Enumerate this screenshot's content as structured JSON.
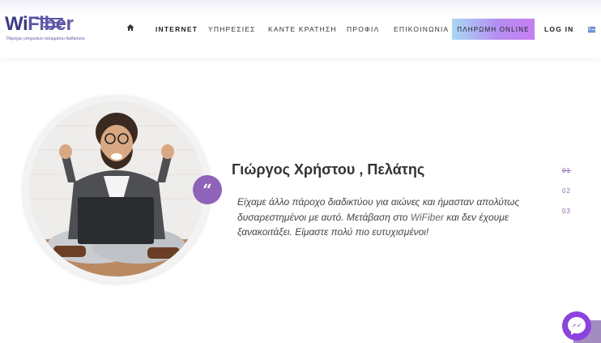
{
  "brand": {
    "logo_text_1": "Wi",
    "logo_text_2": "Fiber",
    "tagline": "Πάροχος υπηρεσιών ασύρματου διαδικτύου"
  },
  "nav": {
    "home_icon": "home-icon",
    "items": [
      "INTERNET",
      "ΥΠΗΡΕΣΙΕΣ",
      "ΚΑΝΤΕ ΚΡΑΤΗΣΗ",
      "ΠΡΟΦΙΛ",
      "ΕΠΙΚΟΙΝΩΝΙΑ"
    ],
    "pay_label": "ΠΛΗΡΩΜΗ ONLINE",
    "login_label": "LOG IN",
    "flag_icon": "greek-flag-icon"
  },
  "testimonial": {
    "quote_mark": "“",
    "name": "Γιώργος Χρήστου , Πελάτης",
    "quote_1": "Είχαμε άλλο πάροχο διαδικτύου για αιώνες και ήμασταν απολύτως δυσαρεστημένοι με αυτό. Μετάβαση στο ",
    "quote_brand": "WiFiber",
    "quote_2": " και δεν έχουμε ξανακοιτάξει. Είμαστε πολύ πιο ευτυχισμένοι!"
  },
  "slides": [
    "01",
    "02",
    "03"
  ],
  "colors": {
    "accent": "#8e63b9",
    "messenger": "#8b42e0"
  }
}
